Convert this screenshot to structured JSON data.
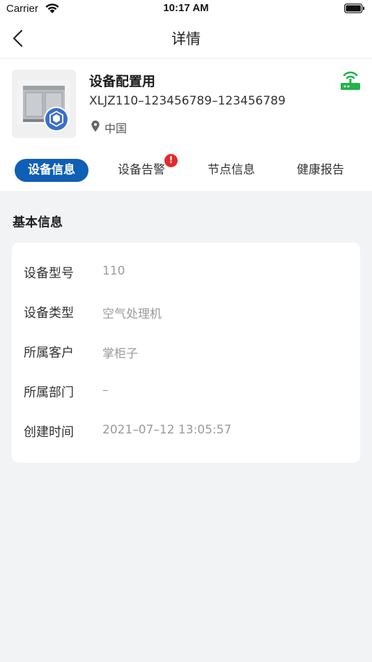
{
  "status_bar": {
    "carrier": "Carrier",
    "time": "10:17 AM"
  },
  "nav": {
    "title": "详情"
  },
  "device": {
    "name": "设备配置用",
    "code": "XLJZ110–123456789–123456789",
    "location": "中国",
    "online_color": "#22b24c"
  },
  "tabs": [
    {
      "label": "设备信息",
      "active": true
    },
    {
      "label": "设备告警",
      "active": false
    },
    {
      "label": "节点信息",
      "active": false
    },
    {
      "label": "健康报告",
      "active": false
    }
  ],
  "alert_badge": "!",
  "section": {
    "title": "基本信息"
  },
  "info_rows": [
    {
      "label": "设备型号",
      "value": "110"
    },
    {
      "label": "设备类型",
      "value": "空气处理机"
    },
    {
      "label": "所属客户",
      "value": "掌柜子"
    },
    {
      "label": "所属部门",
      "value": "–"
    },
    {
      "label": "创建时间",
      "value": "2021–07–12 13:05:57"
    }
  ],
  "colors": {
    "accent": "#0e5fb5",
    "alert": "#e4292e",
    "background": "#f2f3f5"
  },
  "icons": {
    "wifi": "wifi-icon",
    "battery": "battery-icon",
    "back": "chevron-left-icon",
    "location": "location-pin-icon",
    "signal": "router-signal-icon",
    "badge": "cube-badge-icon"
  }
}
